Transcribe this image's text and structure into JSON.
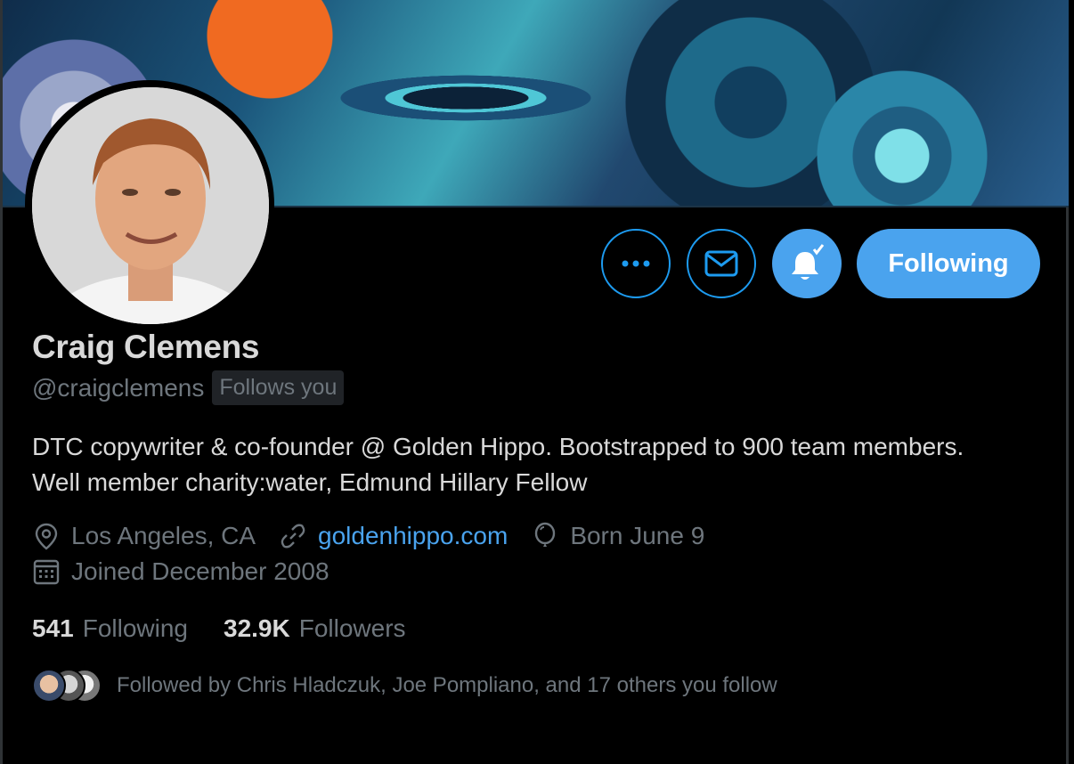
{
  "profile": {
    "name": "Craig Clemens",
    "handle": "@craigclemens",
    "follows_you_badge": "Follows you",
    "bio": "DTC copywriter & co-founder @ Golden Hippo. Bootstrapped to 900 team members. Well member charity:water, Edmund Hillary Fellow",
    "location": "Los Angeles, CA",
    "website": "goldenhippo.com",
    "birthday": "Born June 9",
    "joined": "Joined December 2008"
  },
  "actions": {
    "more_icon": "more-horizontal-icon",
    "message_icon": "envelope-icon",
    "notify_icon": "bell-check-icon",
    "following_label": "Following"
  },
  "stats": {
    "following_count": "541",
    "following_label": "Following",
    "followers_count": "32.9K",
    "followers_label": "Followers"
  },
  "followed_by": {
    "text": "Followed by Chris Hladczuk, Joe Pompliano, and 17 others you follow"
  },
  "colors": {
    "background": "#000000",
    "accent": "#4aa3ee",
    "text_primary": "#d9d9d9",
    "text_secondary": "#6e767d"
  }
}
